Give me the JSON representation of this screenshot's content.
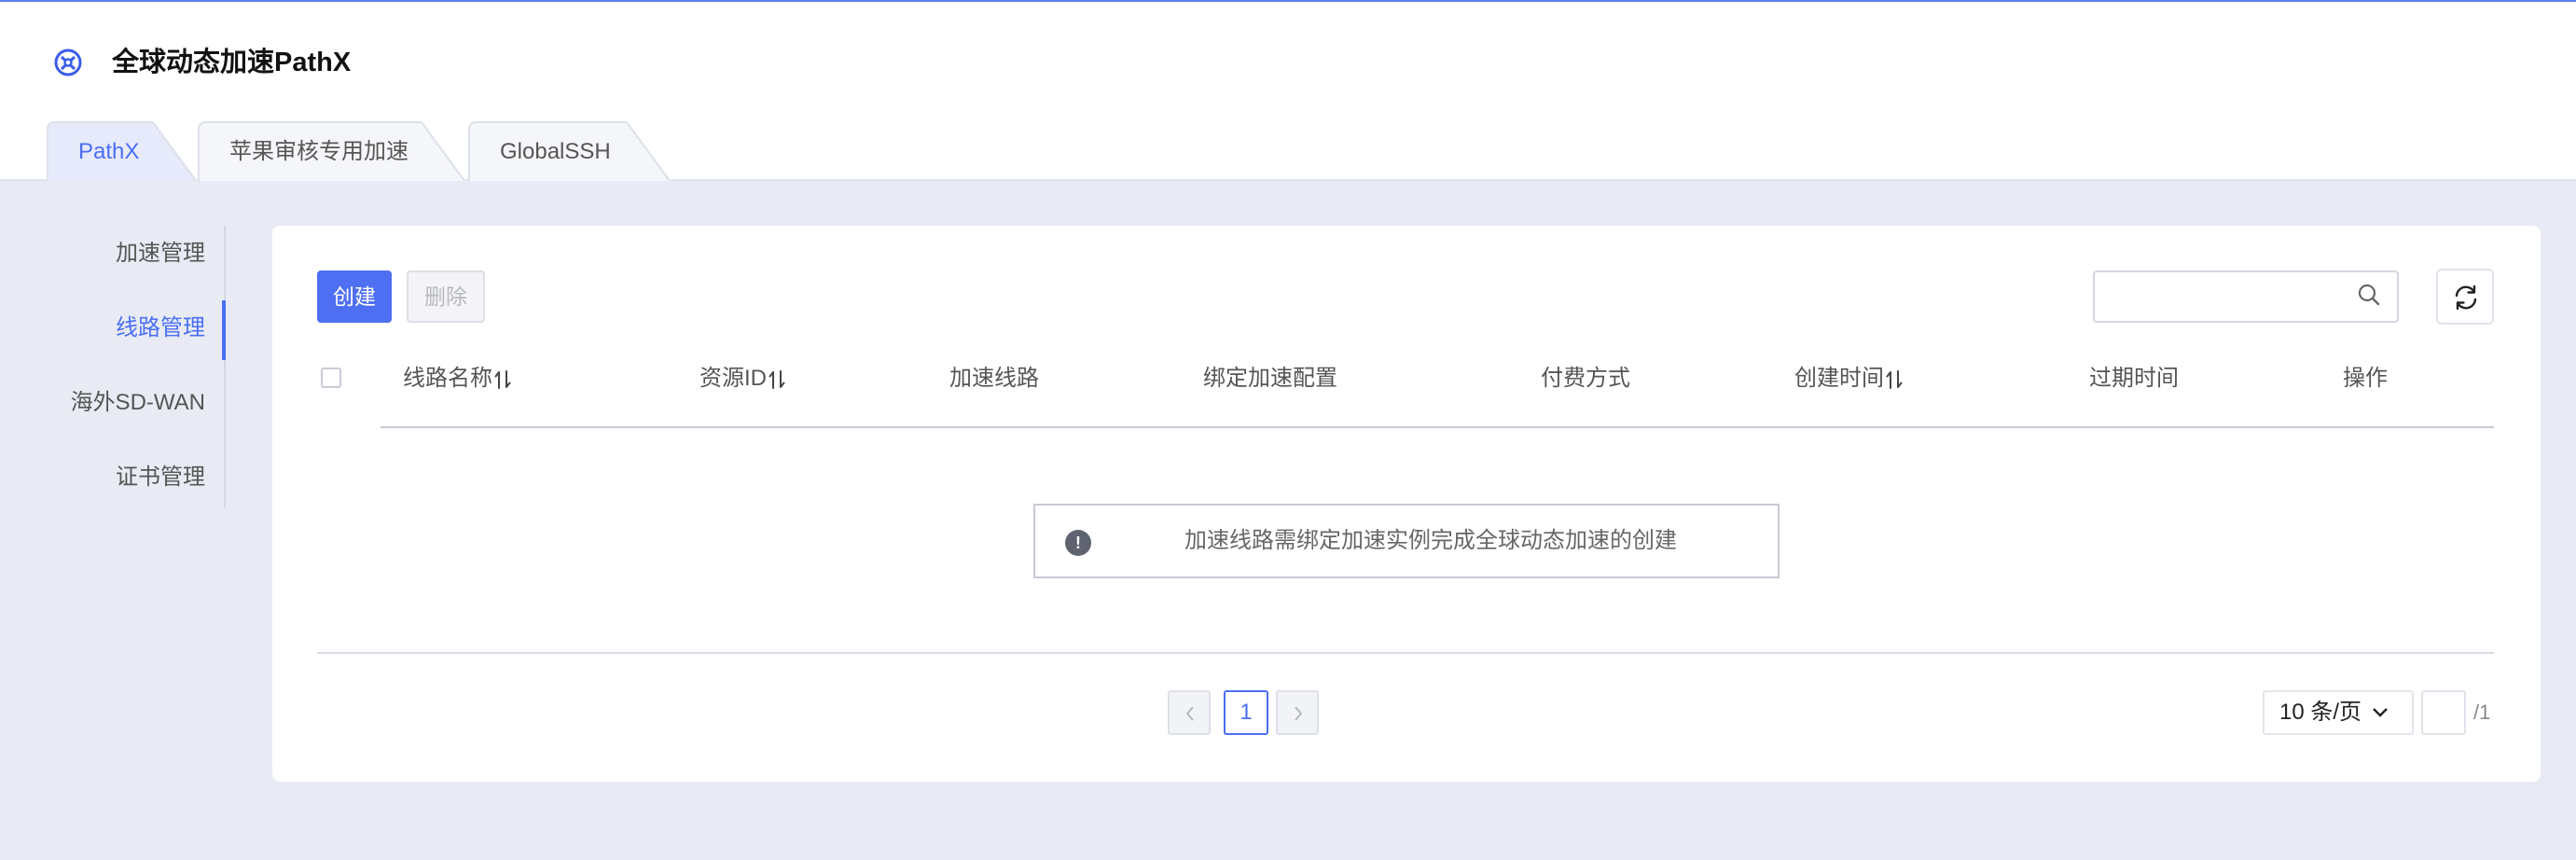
{
  "app": {
    "title": "全球动态加速PathX"
  },
  "tabs": [
    {
      "label": "PathX",
      "active": true
    },
    {
      "label": "苹果审核专用加速",
      "active": false
    },
    {
      "label": "GlobalSSH",
      "active": false
    }
  ],
  "sidebar": {
    "items": [
      {
        "label": "加速管理",
        "active": false
      },
      {
        "label": "线路管理",
        "active": true
      },
      {
        "label": "海外SD-WAN",
        "active": false
      },
      {
        "label": "证书管理",
        "active": false
      }
    ]
  },
  "toolbar": {
    "create_label": "创建",
    "delete_label": "删除",
    "search_placeholder": "",
    "search_icon": "search-icon",
    "refresh_icon": "refresh-icon"
  },
  "table": {
    "columns": [
      {
        "label": "线路名称",
        "sortable": true
      },
      {
        "label": "资源ID",
        "sortable": true
      },
      {
        "label": "加速线路",
        "sortable": false
      },
      {
        "label": "绑定加速配置",
        "sortable": false
      },
      {
        "label": "付费方式",
        "sortable": false
      },
      {
        "label": "创建时间",
        "sortable": true
      },
      {
        "label": "过期时间",
        "sortable": false
      },
      {
        "label": "操作",
        "sortable": false
      }
    ],
    "rows": [],
    "empty_text": "加速线路需绑定加速实例完成全球动态加速的创建"
  },
  "pagination": {
    "current_page": "1",
    "page_size_label": "10 条/页",
    "total_pages_label": "/1"
  },
  "colors": {
    "accent": "#4b6ef5",
    "primary_button": "#4f6ff2",
    "page_background": "#e8ebf3"
  }
}
